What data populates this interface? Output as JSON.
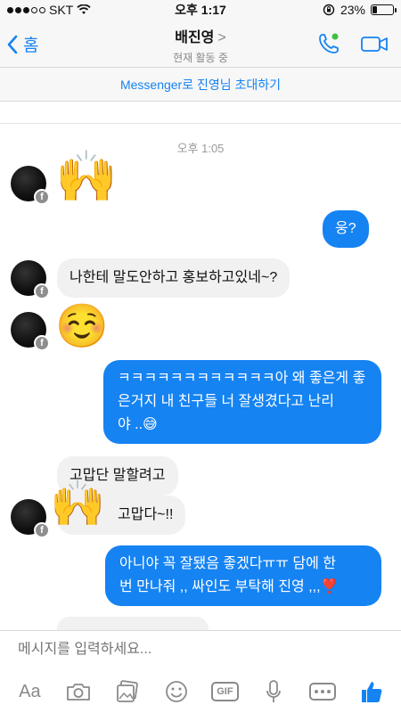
{
  "status_bar": {
    "carrier": "SKT",
    "time": "오후 1:17",
    "battery_percent": "23%",
    "battery_level": 0.23
  },
  "header": {
    "back_label": "홈",
    "contact_name": "배진영",
    "chevron": ">",
    "status": "현재 활동 중",
    "call_icon": "phone-icon",
    "video_icon": "video-camera-icon"
  },
  "invite_banner": "Messenger로 진영님 초대하기",
  "timestamp": "오후 1:05",
  "messages": [
    {
      "side": "in",
      "type": "emoji",
      "text": "🙌"
    },
    {
      "side": "out",
      "type": "text",
      "text": "웅?"
    },
    {
      "side": "in",
      "type": "text",
      "text": "나한테 말도안하고 홍보하고있네~?"
    },
    {
      "side": "in",
      "type": "emoji",
      "text": "☺️"
    },
    {
      "side": "out",
      "type": "text",
      "line1": "ㅋㅋㅋㅋㅋㅋㅋㅋㅋㅋㅋㅋ아 왜 좋은게 좋",
      "line2": "은거지 내 친구들 너 잘생겼다고 난리",
      "line3": "야 ..😅"
    },
    {
      "side": "in",
      "type": "text",
      "text": "고맙단 말할려고"
    },
    {
      "side": "in",
      "type": "text",
      "text": "고맙다~!!"
    },
    {
      "side": "in",
      "type": "emoji",
      "text": "🙌"
    },
    {
      "side": "out",
      "type": "text",
      "line1": "아니야 꼭 잘됐음 좋겠다ㅠㅠ 담에 한",
      "line2": "번 만나줘 ,, 싸인도 부탁해 진영 ,,,❣️"
    }
  ],
  "composer": {
    "placeholder": "메시지를 입력하세요...",
    "aa_label": "Aa",
    "gif_label": "GIF"
  },
  "colors": {
    "accent": "#1583f2",
    "incoming_bubble": "#f1f1f1",
    "toolbar_icon": "#8a8a8a"
  }
}
